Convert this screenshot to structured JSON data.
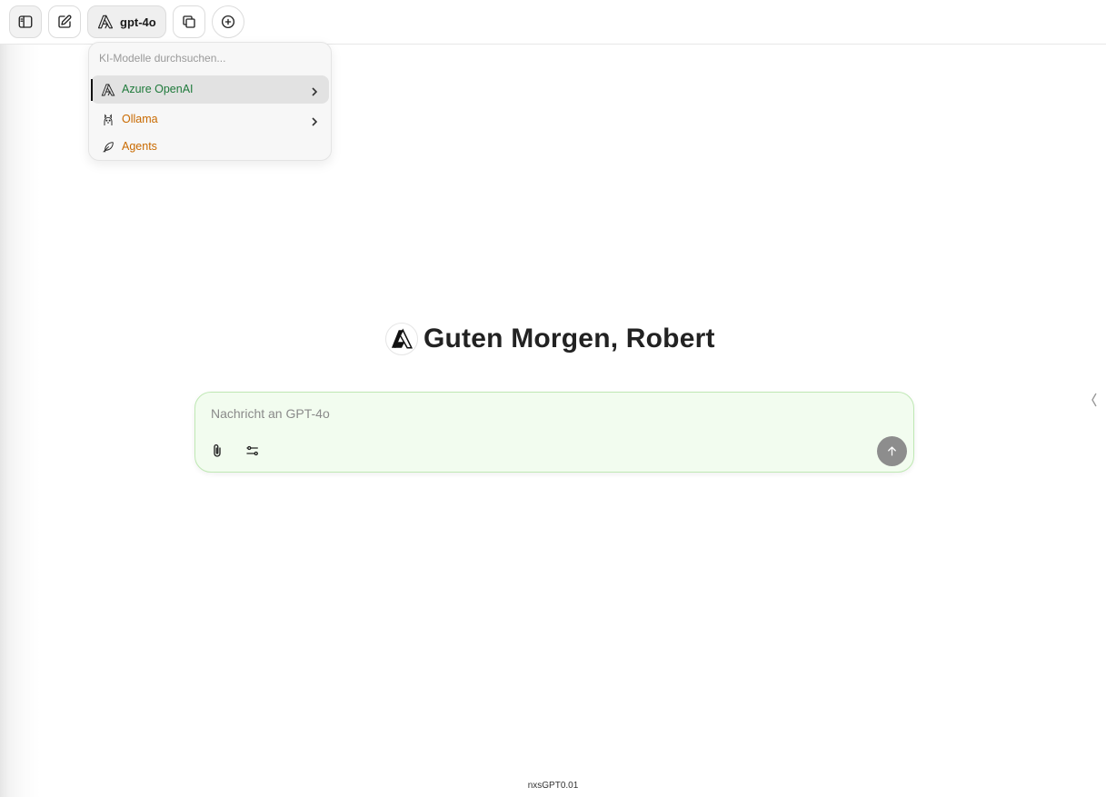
{
  "header": {
    "model_button_label": "gpt-4o",
    "icons": [
      "sidebar-toggle-icon",
      "new-chat-icon",
      "azure-logo-icon",
      "copy-icon",
      "add-circle-icon"
    ]
  },
  "model_menu": {
    "search_placeholder": "KI-Modelle durchsuchen...",
    "items": [
      {
        "label": "Azure OpenAI",
        "color": "#1f7a3b",
        "icon": "azure-logo-icon",
        "has_submenu": true,
        "selected": true
      },
      {
        "label": "Ollama",
        "color": "#c96a00",
        "icon": "ollama-icon",
        "has_submenu": true,
        "selected": false
      },
      {
        "label": "Agents",
        "color": "#c96a00",
        "icon": "feather-icon",
        "has_submenu": false,
        "selected": false
      }
    ]
  },
  "main": {
    "greeting": "Guten Morgen, Robert"
  },
  "composer": {
    "placeholder": "Nachricht an GPT-4o",
    "value": "",
    "accent": "#bfe8b4"
  },
  "footer": {
    "version": "nxsGPT0.01"
  }
}
